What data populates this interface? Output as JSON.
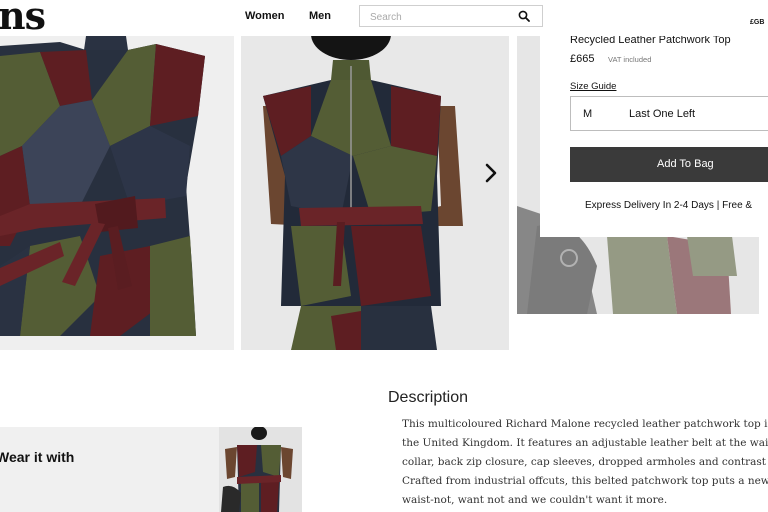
{
  "header": {
    "logo_text": "ns",
    "nav": [
      {
        "label": "Women"
      },
      {
        "label": "Men"
      }
    ],
    "search": {
      "placeholder": "Search",
      "value": ""
    },
    "currency": "£GB"
  },
  "gallery": {
    "next_icon": "chevron-right-icon"
  },
  "product": {
    "name": "Recycled Leather Patchwork Top",
    "price": "£665",
    "vat_note": "VAT included",
    "size_guide_label": "Size Guide",
    "size_selected": "M",
    "stock_note": "Last One Left",
    "add_to_bag_label": "Add To Bag",
    "delivery_text": "Express Delivery In 2-4 Days | Free &"
  },
  "description": {
    "heading": "Description",
    "lines": [
      "This multicoloured Richard Malone recycled leather patchwork top is mac",
      "the United Kingdom. It features an adjustable leather belt at the waist, sta",
      "collar, back zip closure, cap sleeves, dropped armholes and contrast stitch",
      "Crafted from industrial offcuts, this belted patchwork top puts a new spin",
      "waist-not, want not and we couldn't want it more."
    ]
  },
  "wear_with": {
    "title": "Wear it with"
  },
  "colors": {
    "burgundy": "#5e1e22",
    "olive": "#535c34",
    "navy": "#1f2838",
    "button": "#3a3a3a"
  }
}
